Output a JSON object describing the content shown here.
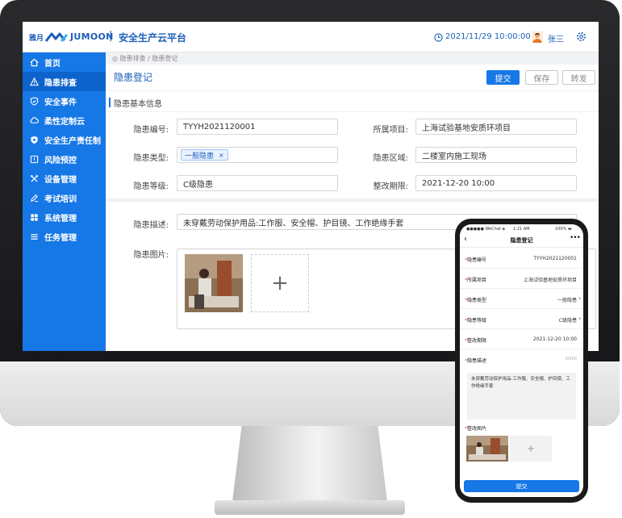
{
  "header": {
    "logo_cn": "雅月",
    "logo_en": "JUMOON",
    "separator": "|",
    "platform_title": "安全生产云平台",
    "datetime": "2021/11/29 10:00:00",
    "username": "张三"
  },
  "sidebar": {
    "items": [
      {
        "label": "首页",
        "icon": "home-icon"
      },
      {
        "label": "隐患排查",
        "icon": "warning-icon",
        "active": true
      },
      {
        "label": "安全事件",
        "icon": "shield-icon"
      },
      {
        "label": "柔性定制云",
        "icon": "cloud-icon"
      },
      {
        "label": "安全生产责任制",
        "icon": "responsibility-icon"
      },
      {
        "label": "风险预控",
        "icon": "risk-icon"
      },
      {
        "label": "设备管理",
        "icon": "tools-icon"
      },
      {
        "label": "考试培训",
        "icon": "exam-icon"
      },
      {
        "label": "系统管理",
        "icon": "grid-icon"
      },
      {
        "label": "任务管理",
        "icon": "list-icon"
      }
    ]
  },
  "breadcrumb": "◎ 隐患排查 / 隐患登记",
  "page": {
    "title": "隐患登记",
    "buttons": {
      "submit": "提交",
      "save": "保存",
      "transfer": "转发"
    },
    "section_title": "隐患基本信息"
  },
  "form": {
    "code_label": "隐患编号:",
    "code_value": "TYYH2021120001",
    "project_label": "所属项目:",
    "project_value": "上海试验基地安质环项目",
    "type_label": "隐患类型:",
    "type_tag": "一般隐患",
    "type_tag_close": "×",
    "area_label": "隐患区域:",
    "area_value": "二楼室内施工现场",
    "level_label": "隐患等级:",
    "level_value": "C级隐患",
    "deadline_label": "整改期限:",
    "deadline_value": "2021-12-20  10:00",
    "desc_label": "隐患描述:",
    "desc_value": "未穿戴劳动保护用品:工作服、安全帽、护目镜、工作绝缘手套",
    "image_label": "隐患图片:",
    "add_symbol": "+"
  },
  "phone": {
    "status": {
      "carrier": "●●●●● WeChat ◈",
      "time": "1:21 AM",
      "battery": "100% ▬"
    },
    "back": "‹",
    "title": "隐患登记",
    "more": "•••",
    "rows": [
      {
        "label": "隐患编号",
        "value": "TYYH2021120001",
        "arrow": ""
      },
      {
        "label": "所属项目",
        "value": "上海试验基地安质环项目",
        "arrow": ""
      },
      {
        "label": "隐患类型",
        "value": "一般隐患",
        "arrow": "›"
      },
      {
        "label": "隐患等级",
        "value": "C级隐患",
        "arrow": "›"
      },
      {
        "label": "整改期限",
        "value": "2021-12-20  10:00",
        "arrow": ""
      }
    ],
    "desc_label": "隐患描述",
    "desc_count": "0/500",
    "desc_value": "未穿戴劳动保护用品:工作服、安全帽、护目镜、工作绝缘手套",
    "image_label": "整改图片",
    "required_mark": "*",
    "add_symbol": "+",
    "submit": "提交"
  },
  "colors": {
    "primary": "#1677e6",
    "sidebar_active": "#0d63cc",
    "brand_text": "#1c5fb8",
    "required": "#e54545"
  }
}
